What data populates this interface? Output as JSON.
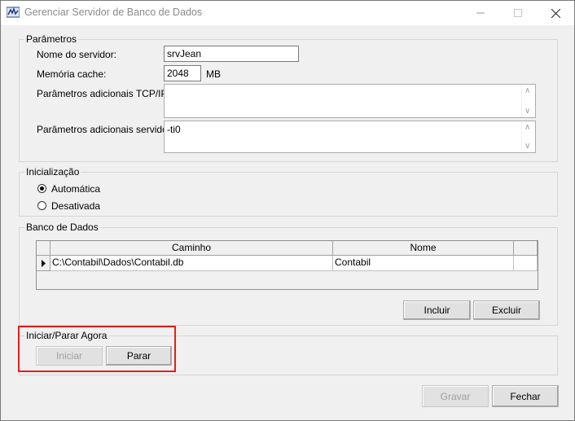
{
  "window": {
    "title": "Gerenciar Servidor de Banco de Dados"
  },
  "parametros": {
    "legend": "Parâmetros",
    "nome_servidor_label": "Nome do servidor:",
    "nome_servidor_value": "srvJean",
    "memoria_label": "Memória cache:",
    "memoria_value": "2048",
    "memoria_unit": "MB",
    "tcpip_label": "Parâmetros adicionais TCP/IP:",
    "tcpip_value": "",
    "servidor_label": "Parâmetros adicionais servidor:",
    "servidor_value": "-ti0"
  },
  "inicializacao": {
    "legend": "Inicialização",
    "options": [
      {
        "label": "Automática",
        "selected": true
      },
      {
        "label": "Desativada",
        "selected": false
      }
    ]
  },
  "banco": {
    "legend": "Banco de Dados",
    "columns": [
      "Caminho",
      "Nome"
    ],
    "rows": [
      {
        "caminho": "C:\\Contabil\\Dados\\Contabil.db",
        "nome": "Contabil"
      }
    ],
    "incluir_label": "Incluir",
    "excluir_label": "Excluir"
  },
  "iniciar_parar": {
    "legend": "Iniciar/Parar Agora",
    "iniciar_label": "Iniciar",
    "parar_label": "Parar"
  },
  "footer": {
    "gravar_label": "Gravar",
    "fechar_label": "Fechar"
  },
  "colors": {
    "highlight": "#e0201a"
  }
}
